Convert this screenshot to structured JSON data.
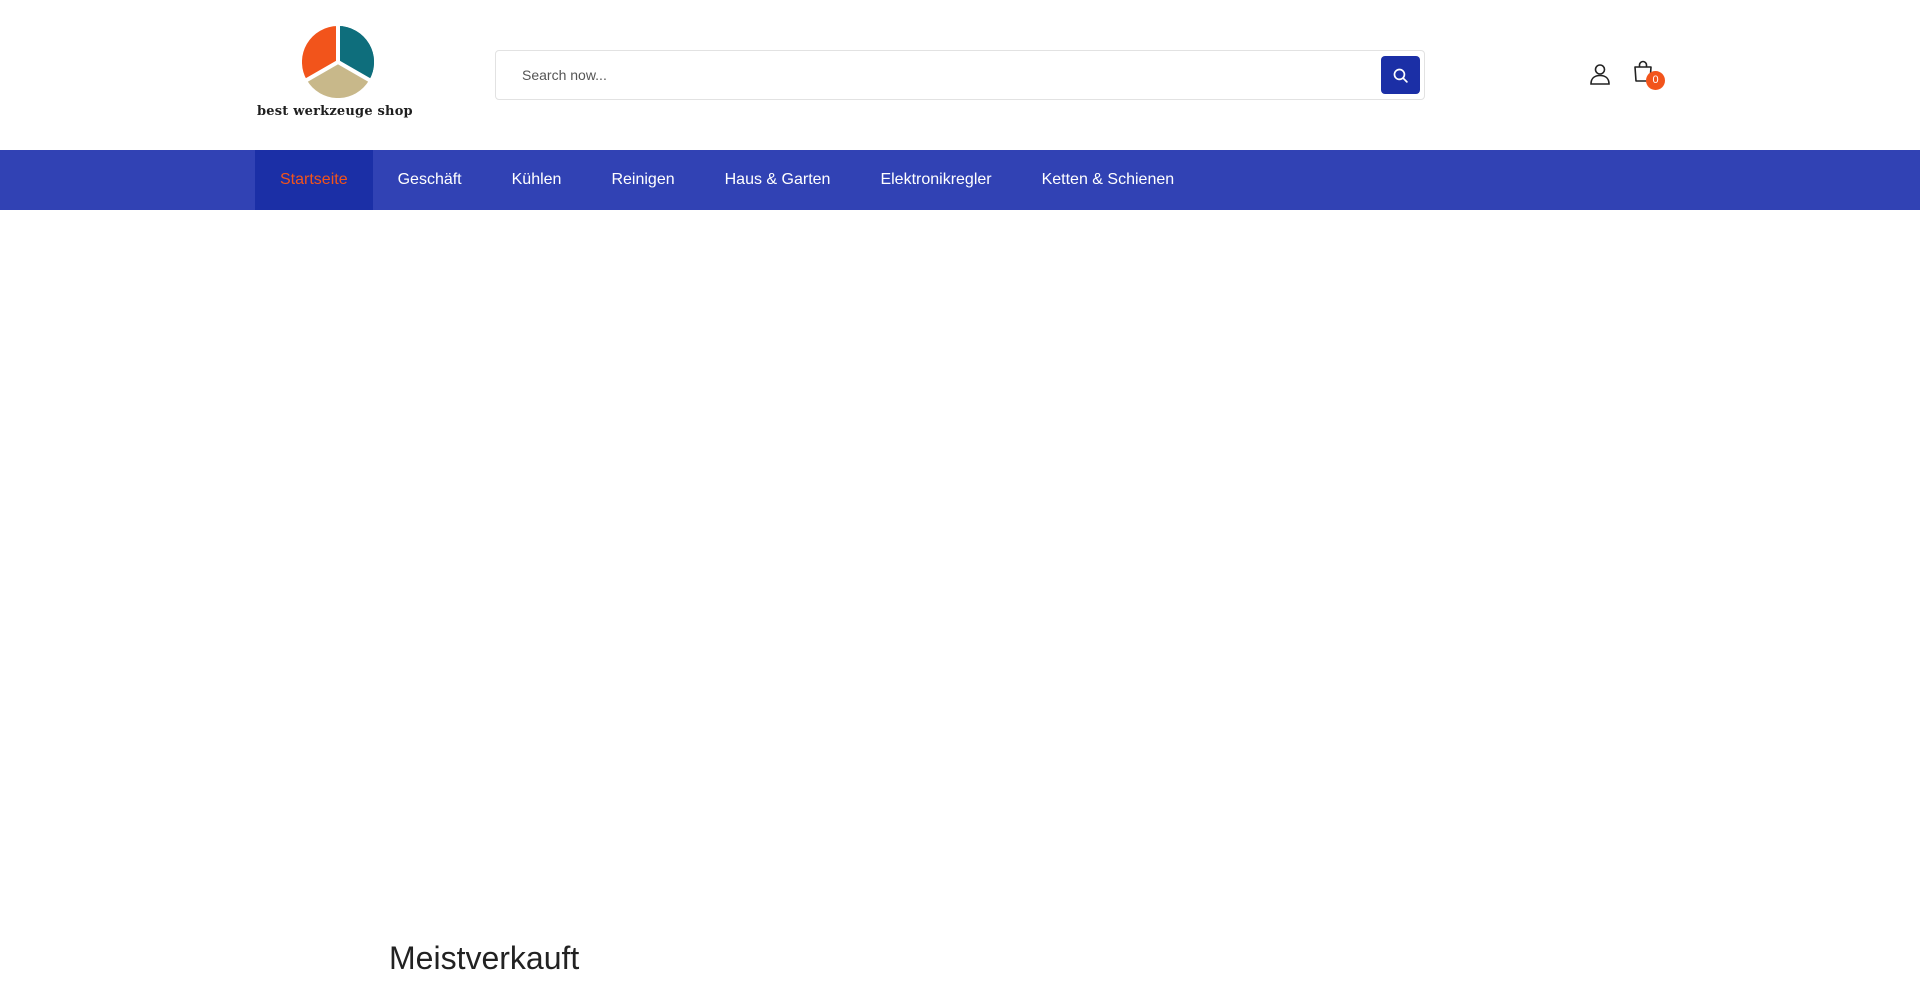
{
  "header": {
    "logo": {
      "name": "best werkzeuge shop",
      "icon": "tri-segment-circle-logo",
      "colors": [
        "#f2541b",
        "#c8b88a",
        "#0e6e7c"
      ]
    },
    "search": {
      "placeholder": "Search now...",
      "value": "",
      "button_icon": "search-icon"
    },
    "account_icon": "user-icon",
    "cart": {
      "icon": "shopping-bag-icon",
      "count": "0"
    }
  },
  "nav": {
    "items": [
      {
        "label": "Startseite",
        "active": true
      },
      {
        "label": "Geschäft",
        "active": false
      },
      {
        "label": "Kühlen",
        "active": false
      },
      {
        "label": "Reinigen",
        "active": false
      },
      {
        "label": "Haus & Garten",
        "active": false
      },
      {
        "label": "Elektronikregler",
        "active": false
      },
      {
        "label": "Ketten & Schienen",
        "active": false
      }
    ]
  },
  "main": {
    "section_title": "Meistverkauft"
  },
  "colors": {
    "nav_bg": "#3142b4",
    "nav_active_bg": "#1b2fa6",
    "accent": "#f2541b",
    "search_button": "#1b2fa6"
  }
}
